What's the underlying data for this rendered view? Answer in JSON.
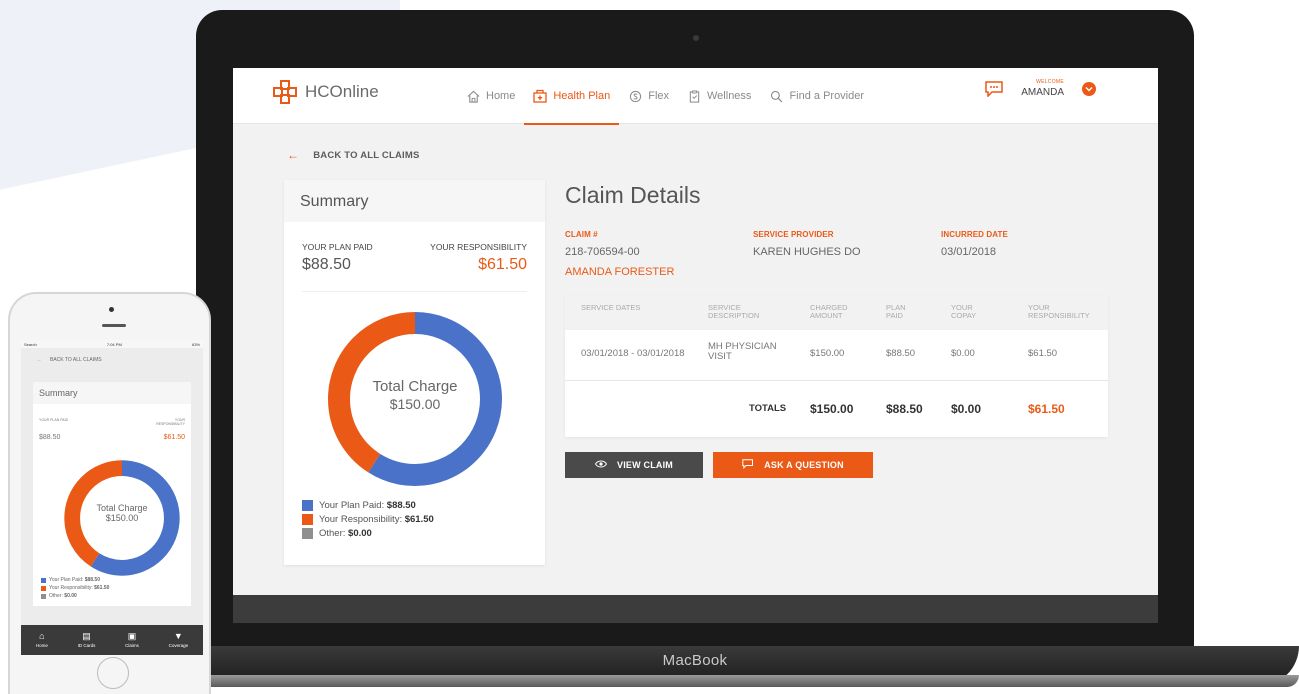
{
  "device": {
    "laptop_label": "MacBook"
  },
  "app": {
    "logo_text": "HCOnline",
    "nav": [
      {
        "label": "Home",
        "icon": "home-icon",
        "active": false
      },
      {
        "label": "Health Plan",
        "icon": "health-plan-icon",
        "active": true
      },
      {
        "label": "Flex",
        "icon": "flex-icon",
        "active": false
      },
      {
        "label": "Wellness",
        "icon": "clipboard-icon",
        "active": false
      },
      {
        "label": "Find a Provider",
        "icon": "search-icon",
        "active": false
      }
    ],
    "welcome_label": "WELCOME",
    "user_name": "AMANDA",
    "accent_color": "#ea5a16",
    "blue_color": "#4a72c8"
  },
  "back_link": "BACK TO ALL CLAIMS",
  "summary": {
    "title": "Summary",
    "plan_paid_label": "YOUR PLAN PAID",
    "plan_paid_value": "$88.50",
    "responsibility_label": "YOUR RESPONSIBILITY",
    "responsibility_value": "$61.50",
    "donut_label": "Total Charge",
    "donut_value": "$150.00",
    "donut_segments": [
      {
        "name": "Your Plan Paid",
        "value": 88.5,
        "color": "#4a72c8"
      },
      {
        "name": "Your Responsibility",
        "value": 61.5,
        "color": "#ea5a16"
      },
      {
        "name": "Other",
        "value": 0,
        "color": "#8f8f8f"
      }
    ],
    "legend": [
      {
        "label": "Your Plan Paid: ",
        "value": "$88.50",
        "color": "#4a72c8"
      },
      {
        "label": "Your Responsibility: ",
        "value": "$61.50",
        "color": "#ea5a16"
      },
      {
        "label": "Other: ",
        "value": "$0.00",
        "color": "#8f8f8f"
      }
    ]
  },
  "claim": {
    "title": "Claim Details",
    "claim_no_label": "CLAIM #",
    "claim_no": "218-706594-00",
    "patient": "AMANDA FORESTER",
    "provider_label": "SERVICE PROVIDER",
    "provider": "KAREN HUGHES DO",
    "incurred_label": "INCURRED DATE",
    "incurred": "03/01/2018",
    "columns": [
      "SERVICE DATES",
      "SERVICE DESCRIPTION",
      "CHARGED AMOUNT",
      "PLAN PAID",
      "YOUR COPAY",
      "YOUR RESPONSIBILITY"
    ],
    "row": {
      "dates": "03/01/2018 - 03/01/2018",
      "description": "MH PHYSICIAN VISIT",
      "charged": "$150.00",
      "plan_paid": "$88.50",
      "copay": "$0.00",
      "responsibility": "$61.50"
    },
    "totals": {
      "label": "TOTALS",
      "charged": "$150.00",
      "plan_paid": "$88.50",
      "copay": "$0.00",
      "responsibility": "$61.50"
    },
    "view_button": "VIEW CLAIM",
    "ask_button": "ASK A QUESTION"
  },
  "phone": {
    "status_left": "Search",
    "status_time": "7:04 PM",
    "status_right": "63%",
    "back_link": "BACK TO ALL CLAIMS",
    "summary_title": "Summary",
    "plan_paid_label": "YOUR PLAN PAID",
    "responsibility_label": "YOUR RESPONSIBILITY",
    "plan_paid_value": "$88.50",
    "responsibility_value": "$61.50",
    "donut_label": "Total Charge",
    "donut_value": "$150.00",
    "legend": [
      {
        "label": "Your Plan Paid: ",
        "value": "$88.50",
        "color": "#4a72c8"
      },
      {
        "label": "Your Responsibility: ",
        "value": "$61.50",
        "color": "#ea5a16"
      },
      {
        "label": "Other: ",
        "value": "$0.00",
        "color": "#8f8f8f"
      }
    ],
    "tabs": [
      {
        "label": "Home",
        "icon": "home-icon"
      },
      {
        "label": "ID Cards",
        "icon": "id-card-icon"
      },
      {
        "label": "Claims",
        "icon": "claims-icon"
      },
      {
        "label": "Coverage",
        "icon": "filter-icon"
      }
    ]
  }
}
